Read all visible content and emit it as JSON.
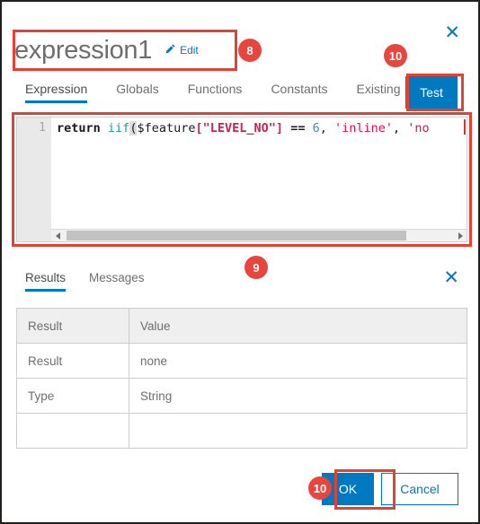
{
  "dialog": {
    "title": "expression1",
    "edit_label": "Edit",
    "close_label": "✕"
  },
  "tabs": [
    {
      "label": "Expression",
      "active": true
    },
    {
      "label": "Globals",
      "active": false
    },
    {
      "label": "Functions",
      "active": false
    },
    {
      "label": "Constants",
      "active": false
    },
    {
      "label": "Existing",
      "active": false
    }
  ],
  "test_button": {
    "label": "Test"
  },
  "editor": {
    "line_number": "1",
    "code_tokens": [
      {
        "text": "return",
        "type": "kw"
      },
      {
        "text": " ",
        "type": "plain"
      },
      {
        "text": "iif",
        "type": "fn"
      },
      {
        "text": "(",
        "type": "paren"
      },
      {
        "text": "$feature",
        "type": "var"
      },
      {
        "text": "[",
        "type": "bracket"
      },
      {
        "text": "\"LEVEL_NO\"",
        "type": "str-d"
      },
      {
        "text": "]",
        "type": "bracket"
      },
      {
        "text": " ",
        "type": "plain"
      },
      {
        "text": "==",
        "type": "op"
      },
      {
        "text": " ",
        "type": "plain"
      },
      {
        "text": "6",
        "type": "num"
      },
      {
        "text": ", ",
        "type": "plain"
      },
      {
        "text": "'inline'",
        "type": "str"
      },
      {
        "text": ", ",
        "type": "plain"
      },
      {
        "text": "'no",
        "type": "str"
      }
    ],
    "code_text": "return iif($feature[\"LEVEL_NO\"] == 6, 'inline', 'no"
  },
  "results_panel": {
    "tabs": [
      {
        "label": "Results",
        "active": true
      },
      {
        "label": "Messages",
        "active": false
      }
    ],
    "close_label": "✕",
    "table": {
      "headers": [
        "Result",
        "Value"
      ],
      "rows": [
        [
          "Result",
          "none"
        ],
        [
          "Type",
          "String"
        ],
        [
          "",
          ""
        ]
      ]
    }
  },
  "footer": {
    "ok_label": "OK",
    "cancel_label": "Cancel"
  },
  "annotations": {
    "badges": [
      {
        "id": "8",
        "label": "8"
      },
      {
        "id": "10a",
        "label": "10"
      },
      {
        "id": "9",
        "label": "9"
      },
      {
        "id": "10b",
        "label": "10"
      }
    ],
    "accent_color": "#e8402f"
  },
  "colors": {
    "brand_blue": "#0079c1",
    "annotation_red": "#e8402f",
    "text_gray": "#6e6e6e"
  }
}
